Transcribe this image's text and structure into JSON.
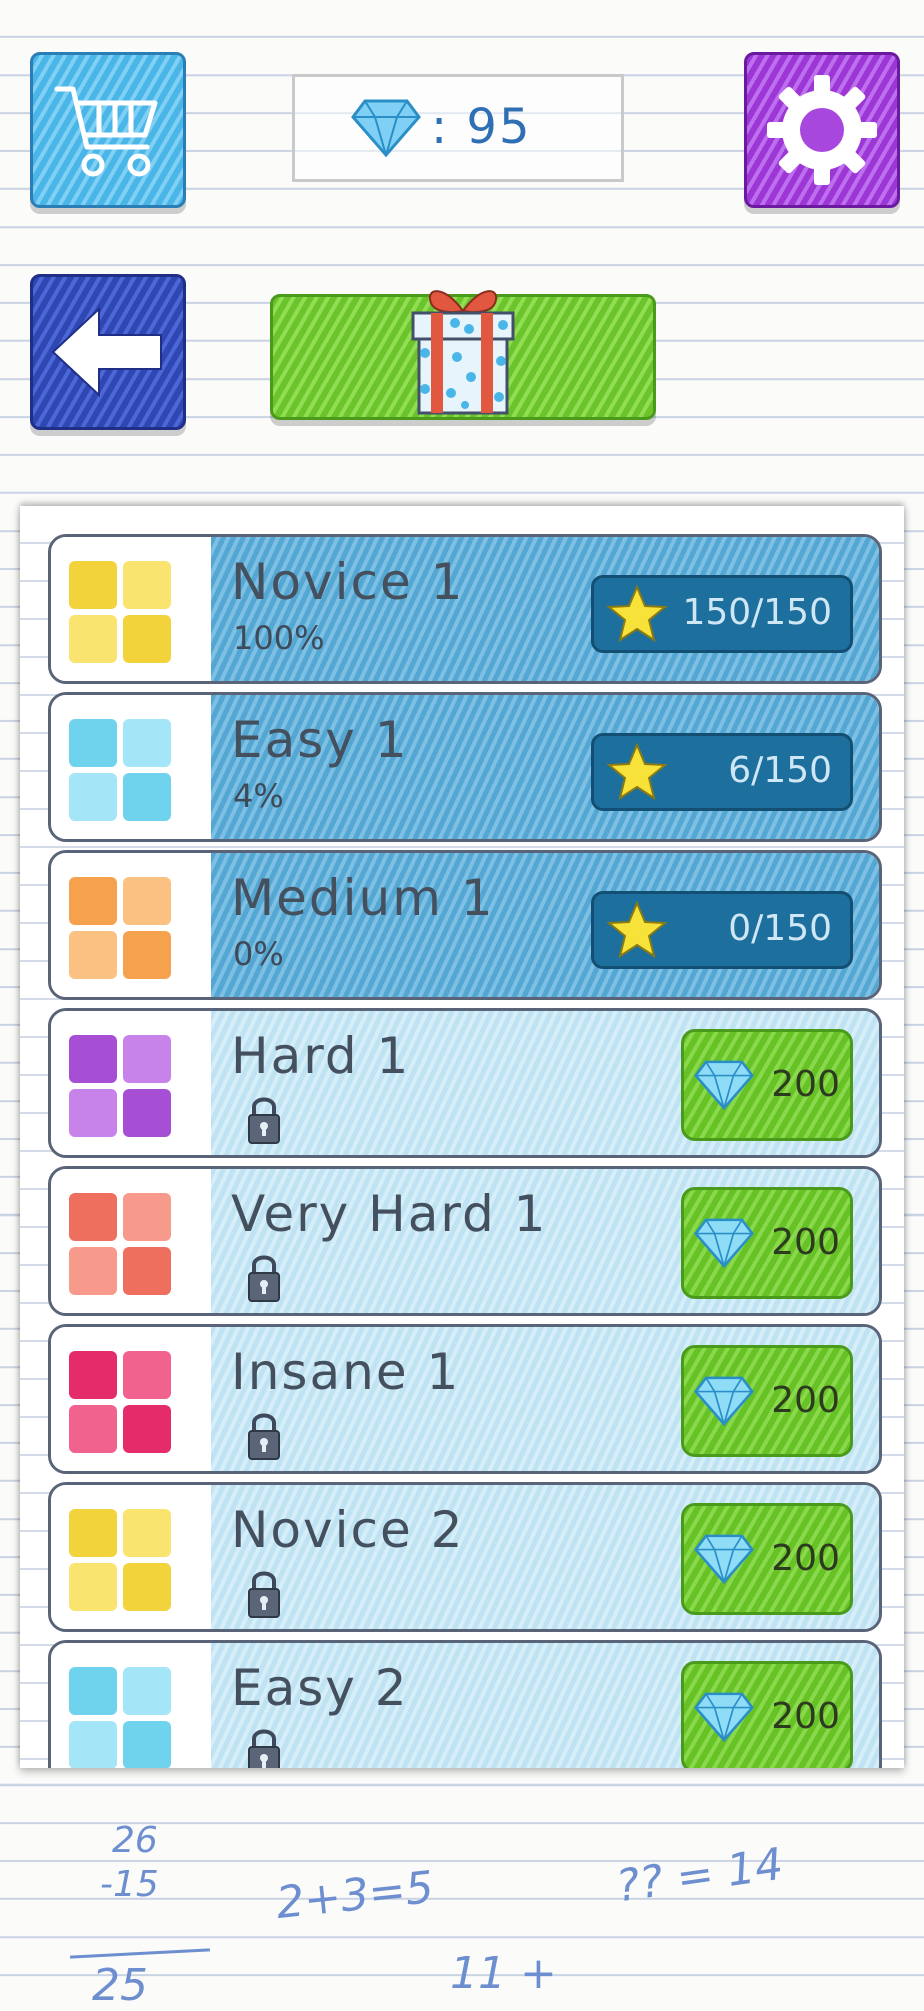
{
  "header": {
    "gem_label": ": 95"
  },
  "levels": [
    {
      "title": "Novice 1",
      "progress": "100%",
      "stars": "150/150",
      "locked": false,
      "colors": [
        "#f3d33b",
        "#f9e470"
      ]
    },
    {
      "title": "Easy 1",
      "progress": "4%",
      "stars": "6/150",
      "locked": false,
      "colors": [
        "#6fd3ee",
        "#a4e6f7"
      ]
    },
    {
      "title": "Medium 1",
      "progress": "0%",
      "stars": "0/150",
      "locked": false,
      "colors": [
        "#f5a14e",
        "#fbc183"
      ]
    },
    {
      "title": "Hard 1",
      "price": "200",
      "locked": true,
      "colors": [
        "#a64fd4",
        "#c783ea"
      ]
    },
    {
      "title": "Very Hard 1",
      "price": "200",
      "locked": true,
      "colors": [
        "#ef6f5e",
        "#f7998b"
      ]
    },
    {
      "title": "Insane 1",
      "price": "200",
      "locked": true,
      "colors": [
        "#e52c6a",
        "#f2628f"
      ]
    },
    {
      "title": "Novice 2",
      "price": "200",
      "locked": true,
      "colors": [
        "#f3d33b",
        "#f9e470"
      ]
    },
    {
      "title": "Easy 2",
      "price": "200",
      "locked": true,
      "colors": [
        "#6fd3ee",
        "#a4e6f7"
      ]
    }
  ],
  "doodles": {
    "a": "26",
    "b": "-15",
    "c": "2+3=5",
    "d": "?? = 14",
    "e": "25",
    "f": "11 +"
  }
}
